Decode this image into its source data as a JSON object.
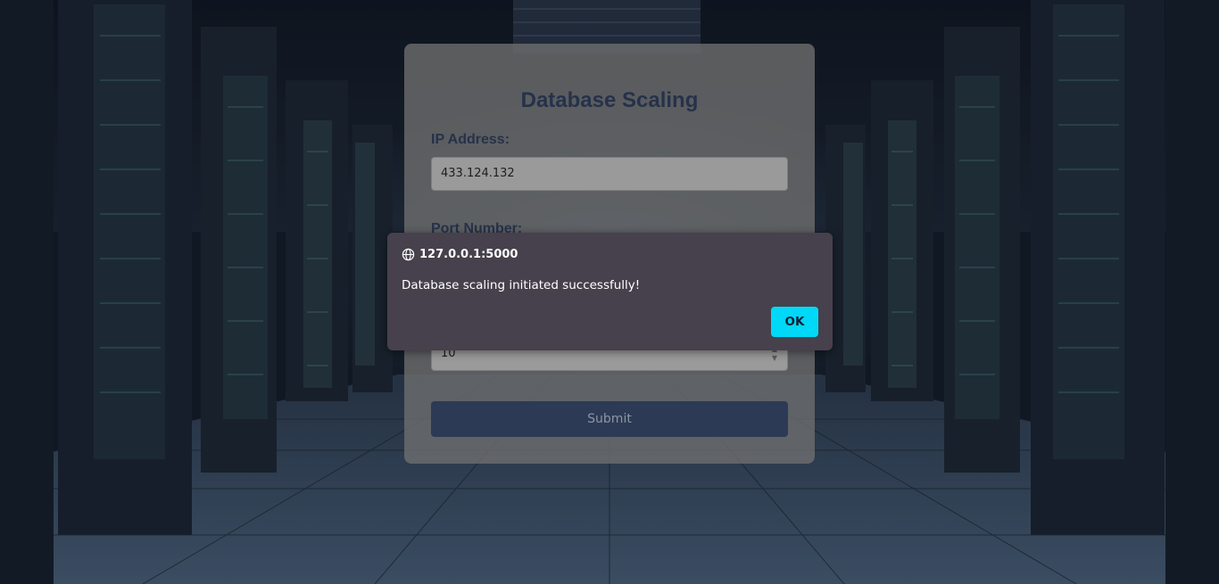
{
  "form": {
    "title": "Database Scaling",
    "ip_label": "IP Address:",
    "ip_value": "433.124.132",
    "port_label": "Port Number:",
    "instances_value": "10",
    "submit_label": "Submit"
  },
  "dialog": {
    "origin": "127.0.0.1:5000",
    "message": "Database scaling initiated successfully!",
    "ok_label": "OK"
  },
  "icons": {
    "origin_icon": "globe-icon",
    "stepper_icon": "stepper-icon"
  },
  "colors": {
    "accent_ok": "#00d8f7",
    "submit_bg": "#2c3a55",
    "title_text": "#26324a",
    "dialog_bg": "#46414c"
  }
}
